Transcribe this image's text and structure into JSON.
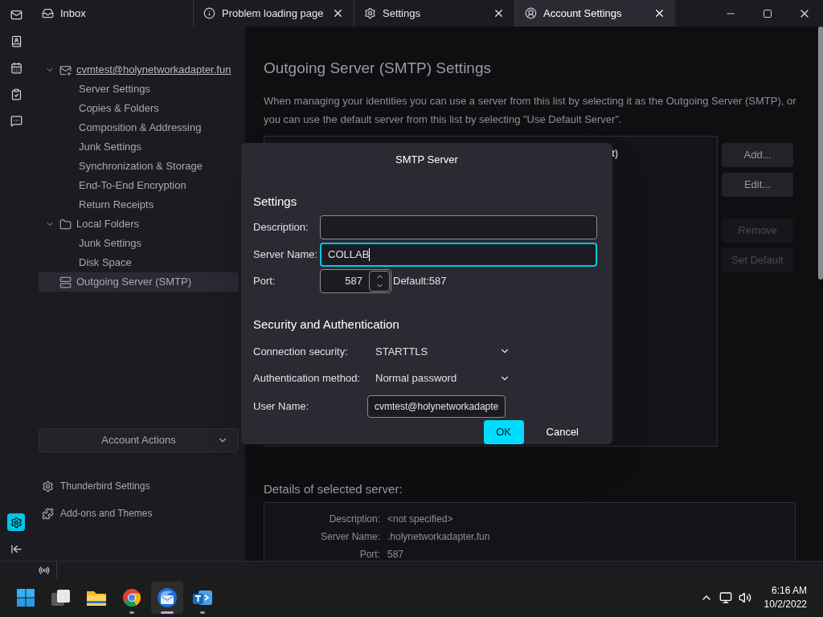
{
  "rail_items": [
    {
      "kind": "mail",
      "selected": false
    },
    {
      "kind": "contacts",
      "selected": false
    },
    {
      "kind": "calendar",
      "selected": false
    },
    {
      "kind": "tasks",
      "selected": false
    },
    {
      "kind": "chat",
      "selected": false
    }
  ],
  "rail_bottom": [
    {
      "kind": "settings",
      "selected": true
    },
    {
      "kind": "collapse",
      "selected": false
    }
  ],
  "tabs": [
    {
      "kind": "inbox",
      "label": "Inbox",
      "selected": false,
      "closable": false
    },
    {
      "kind": "info",
      "label": "Problem loading page",
      "selected": false,
      "closable": true
    },
    {
      "kind": "settings",
      "label": "Settings",
      "selected": false,
      "closable": true
    },
    {
      "kind": "account",
      "label": "Account Settings",
      "selected": true,
      "closable": true
    }
  ],
  "account_tree": [
    {
      "kind": "account",
      "label": "cvmtest@holynetworkadapter.fun",
      "expanded": true,
      "selected": false,
      "children": [
        {
          "label": "Server Settings",
          "selected": false
        },
        {
          "label": "Copies & Folders",
          "selected": false
        },
        {
          "label": "Composition & Addressing",
          "selected": false
        },
        {
          "label": "Junk Settings",
          "selected": false
        },
        {
          "label": "Synchronization & Storage",
          "selected": false
        },
        {
          "label": "End-To-End Encryption",
          "selected": false
        },
        {
          "label": "Return Receipts",
          "selected": false
        }
      ]
    },
    {
      "kind": "folder",
      "label": "Local Folders",
      "expanded": true,
      "selected": false,
      "children": [
        {
          "label": "Junk Settings",
          "selected": false
        },
        {
          "label": "Disk Space",
          "selected": false
        }
      ]
    },
    {
      "kind": "smtp",
      "label": "Outgoing Server (SMTP)",
      "selected": true
    }
  ],
  "account_actions": "Account Actions",
  "sidebar_links": [
    {
      "kind": "settings",
      "label": "Thunderbird Settings"
    },
    {
      "kind": "addons",
      "label": "Add-ons and Themes"
    }
  ],
  "page": {
    "title": "Outgoing Server (SMTP) Settings",
    "description": "When managing your identities you can use a server from this list by selecting it as the Outgoing Server (SMTP), or you can use the default server from this list by selecting \"Use Default Server\".",
    "server_list": {
      "column_1": "t)"
    },
    "buttons": [
      {
        "label": "Add...",
        "disabled": false
      },
      {
        "label": "Edit...",
        "disabled": false
      },
      {
        "label": "Remove",
        "disabled": true
      },
      {
        "label": "Set Default",
        "disabled": true
      }
    ],
    "details": {
      "title": "Details of selected server:",
      "rows": [
        {
          "label": "Description:",
          "value": "<not specified>"
        },
        {
          "label": "Server Name:",
          "value": ".holynetworkadapter.fun"
        },
        {
          "label": "Port:",
          "value": "587"
        }
      ]
    }
  },
  "dialog": {
    "title": "SMTP Server",
    "settings_heading": "Settings",
    "description": {
      "label": "Description:",
      "focused": false
    },
    "server_name": {
      "label": "Server Name:",
      "value": "COLLAB",
      "focused": true
    },
    "port": {
      "label": "Port:",
      "value": "587",
      "hint": "Default:587"
    },
    "security_heading": "Security and Authentication",
    "selects": [
      {
        "label": "Connection security:",
        "value": "STARTTLS"
      },
      {
        "label": "Authentication method:",
        "value": "Normal password"
      }
    ],
    "user_name": {
      "label": "User Name:",
      "value": "cvmtest@holynetworkadapte"
    },
    "buttons": [
      {
        "label": "OK",
        "primary": true
      },
      {
        "label": "Cancel",
        "primary": false
      }
    ]
  },
  "taskbar": {
    "apps": [
      {
        "kind": "start",
        "running": false,
        "active": false
      },
      {
        "kind": "taskview",
        "running": false,
        "active": false
      },
      {
        "kind": "explorer",
        "running": false,
        "active": false
      },
      {
        "kind": "chrome",
        "running": true,
        "active": false
      },
      {
        "kind": "thunderbird",
        "running": true,
        "active": true
      },
      {
        "kind": "teams",
        "running": true,
        "active": false
      }
    ],
    "time": "6:16 AM",
    "date": "10/2/2022"
  }
}
